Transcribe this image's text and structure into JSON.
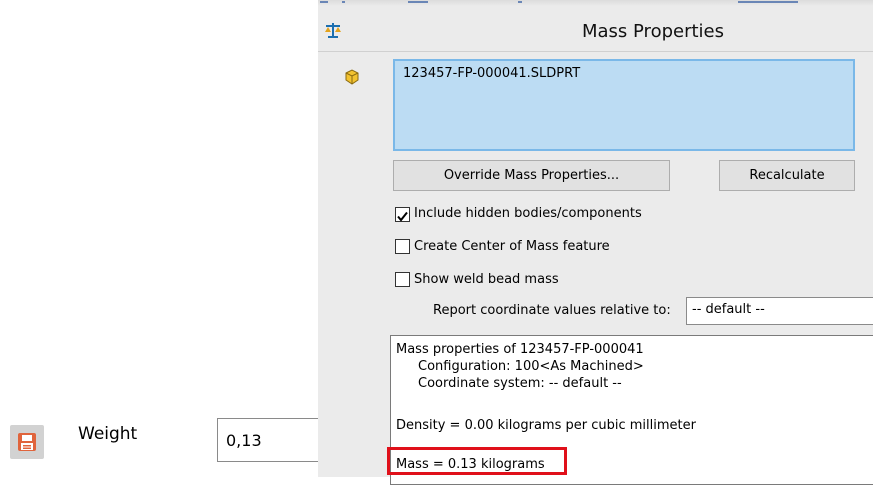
{
  "weight_panel": {
    "label": "Weight",
    "value": "0,13",
    "icon": "save-icon"
  },
  "dialog": {
    "title": "Mass Properties",
    "title_icon": "scale-icon",
    "part_icon": "part-icon",
    "selected_item": "123457-FP-000041.SLDPRT",
    "override_button": "Override Mass Properties...",
    "recalculate_button": "Recalculate",
    "options": [
      {
        "label": "Include hidden bodies/components",
        "checked": true
      },
      {
        "label": "Create Center of Mass feature",
        "checked": false
      },
      {
        "label": "Show weld bead mass",
        "checked": false
      }
    ],
    "report_label": "Report coordinate values relative to:",
    "coordinate_system": "-- default --",
    "results": {
      "header": "Mass properties of 123457-FP-000041",
      "configuration": "Configuration: 100<As Machined>",
      "coordinate_system": "Coordinate system: -- default --",
      "density": "Density = 0.00 kilograms per cubic millimeter",
      "mass": "Mass = 0.13 kilograms"
    },
    "highlight_color": "#e0101a"
  }
}
